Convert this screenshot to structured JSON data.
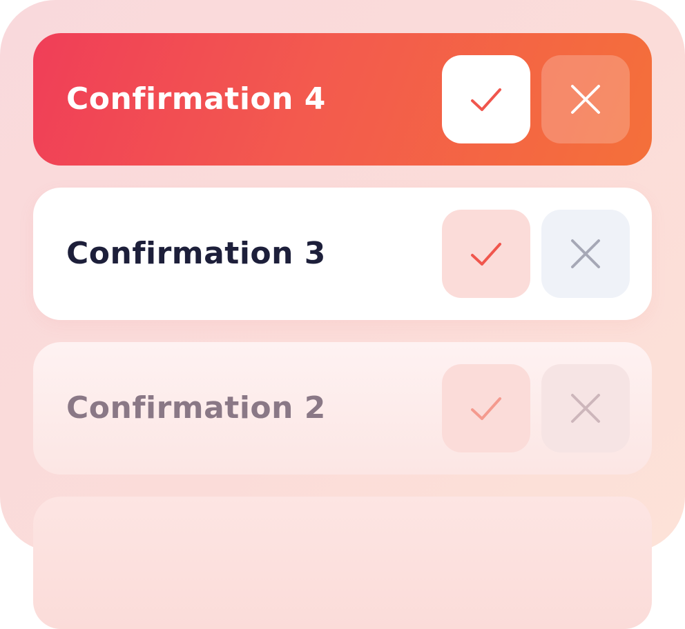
{
  "confirmations": [
    {
      "label": "Confirmation 4",
      "accept_icon": "check-icon",
      "reject_icon": "close-icon",
      "accept_color": "#f0564d",
      "reject_color": "#ffffff",
      "state": "active"
    },
    {
      "label": "Confirmation 3",
      "accept_icon": "check-icon",
      "reject_icon": "close-icon",
      "accept_color": "#f0564d",
      "reject_color": "#a6a8b6",
      "state": "default"
    },
    {
      "label": "Confirmation 2",
      "accept_icon": "check-icon",
      "reject_icon": "close-icon",
      "accept_color": "#f49a8e",
      "reject_color": "#cdb6bb",
      "state": "faded"
    }
  ],
  "colors": {
    "active_gradient_start": "#f03e58",
    "active_gradient_end": "#f4703a",
    "panel_background": "#fbdcd9",
    "dark_text": "#1d1f3a",
    "faded_text": "#8a7886"
  }
}
